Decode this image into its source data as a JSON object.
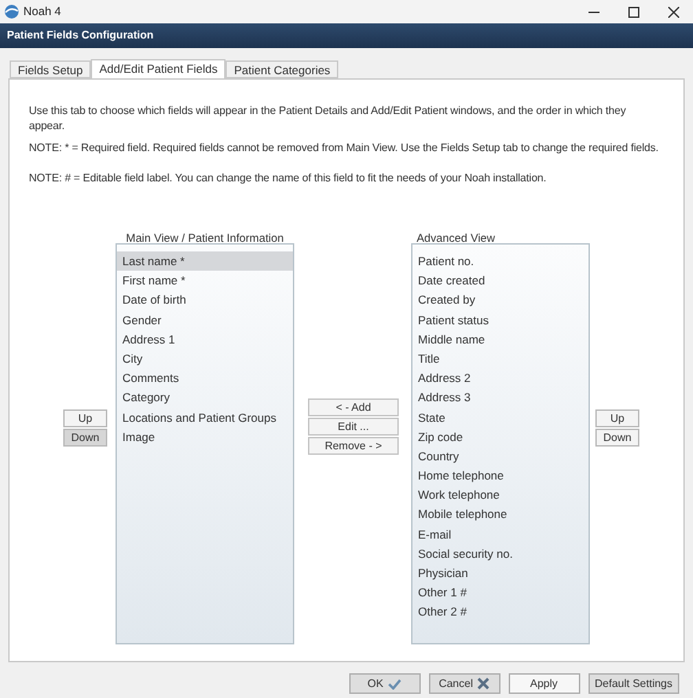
{
  "window": {
    "title": "Noah 4"
  },
  "header": {
    "title": "Patient Fields Configuration"
  },
  "tabs": [
    {
      "label": "Fields Setup",
      "selected": false
    },
    {
      "label": "Add/Edit Patient Fields",
      "selected": true
    },
    {
      "label": "Patient Categories",
      "selected": false
    }
  ],
  "notes": [
    "Use this tab to choose which fields will appear in the Patient Details and Add/Edit Patient windows, and the order in which they appear.",
    "NOTE: * = Required field. Required fields cannot be removed from Main View. Use the Fields Setup tab to change the required fields.",
    "NOTE: # = Editable field label. You can change the name of this field to fit the needs of your Noah installation."
  ],
  "main_view": {
    "label": "Main View / Patient Information",
    "items": [
      {
        "label": "Last name *",
        "selected": true
      },
      {
        "label": "First name *",
        "selected": false
      },
      {
        "label": "Date of birth",
        "selected": false
      },
      {
        "label": "Gender",
        "selected": false
      },
      {
        "label": "Address 1",
        "selected": false
      },
      {
        "label": "City",
        "selected": false
      },
      {
        "label": "Comments",
        "selected": false
      },
      {
        "label": "Category",
        "selected": false
      },
      {
        "label": "Locations and Patient Groups",
        "selected": false
      },
      {
        "label": "Image",
        "selected": false
      }
    ],
    "buttons": [
      {
        "label": "Up",
        "highlighted": false
      },
      {
        "label": "Down",
        "highlighted": true
      }
    ]
  },
  "transfer_buttons": [
    "< - Add",
    "Edit ...",
    "Remove - >"
  ],
  "advanced_view": {
    "label": "Advanced View",
    "items": [
      {
        "label": "Patient no.",
        "selected": false
      },
      {
        "label": "Date created",
        "selected": false
      },
      {
        "label": "Created by",
        "selected": false
      },
      {
        "label": "Patient status",
        "selected": false
      },
      {
        "label": "Middle name",
        "selected": false
      },
      {
        "label": "Title",
        "selected": false
      },
      {
        "label": "Address 2",
        "selected": false
      },
      {
        "label": "Address 3",
        "selected": false
      },
      {
        "label": "State",
        "selected": false
      },
      {
        "label": "Zip code",
        "selected": false
      },
      {
        "label": "Country",
        "selected": false
      },
      {
        "label": "Home telephone",
        "selected": false
      },
      {
        "label": "Work telephone",
        "selected": false
      },
      {
        "label": "Mobile telephone",
        "selected": false
      },
      {
        "label": "E-mail",
        "selected": false
      },
      {
        "label": "Social security no.",
        "selected": false
      },
      {
        "label": "Physician",
        "selected": false
      },
      {
        "label": "Other 1 #",
        "selected": false
      },
      {
        "label": "Other 2 #",
        "selected": false
      }
    ],
    "buttons": [
      {
        "label": "Up",
        "highlighted": false
      },
      {
        "label": "Down",
        "highlighted": false
      }
    ]
  },
  "footer_buttons": [
    {
      "label": "OK",
      "highlighted": true
    },
    {
      "label": "Cancel",
      "highlighted": true
    },
    {
      "label": "Apply",
      "highlighted": false
    },
    {
      "label": "Default Settings",
      "highlighted": true
    }
  ]
}
